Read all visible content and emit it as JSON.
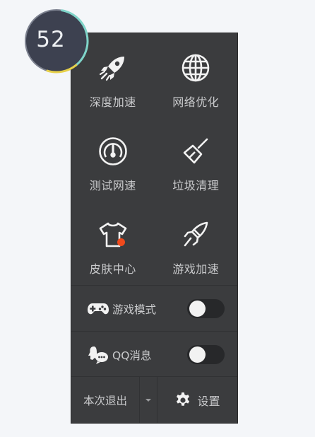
{
  "speed_ball": {
    "value": "52",
    "progress_percent": 52,
    "arc_color": "#7fd4c9"
  },
  "tools": [
    {
      "label": "深度加速",
      "icon": "rocket-icon"
    },
    {
      "label": "网络优化",
      "icon": "globe-icon"
    },
    {
      "label": "测试网速",
      "icon": "speedometer-icon"
    },
    {
      "label": "垃圾清理",
      "icon": "broom-icon"
    },
    {
      "label": "皮肤中心",
      "icon": "tshirt-icon",
      "badge_color": "#f04a1c"
    },
    {
      "label": "游戏加速",
      "icon": "game-boost-icon"
    }
  ],
  "toggles": [
    {
      "label": "游戏模式",
      "icon": "gamepad-icon",
      "on": false
    },
    {
      "label": "QQ消息",
      "icon": "qq-message-icon",
      "on": false
    }
  ],
  "footer": {
    "exit_label": "本次退出",
    "dropdown_icon": "chevron-down-icon",
    "settings_label": "设置",
    "settings_icon": "gear-icon"
  },
  "colors": {
    "panel_bg": "#3b3c3e",
    "text": "#c9cacc",
    "icon": "#f2f2f2",
    "badge": "#f04a1c"
  }
}
